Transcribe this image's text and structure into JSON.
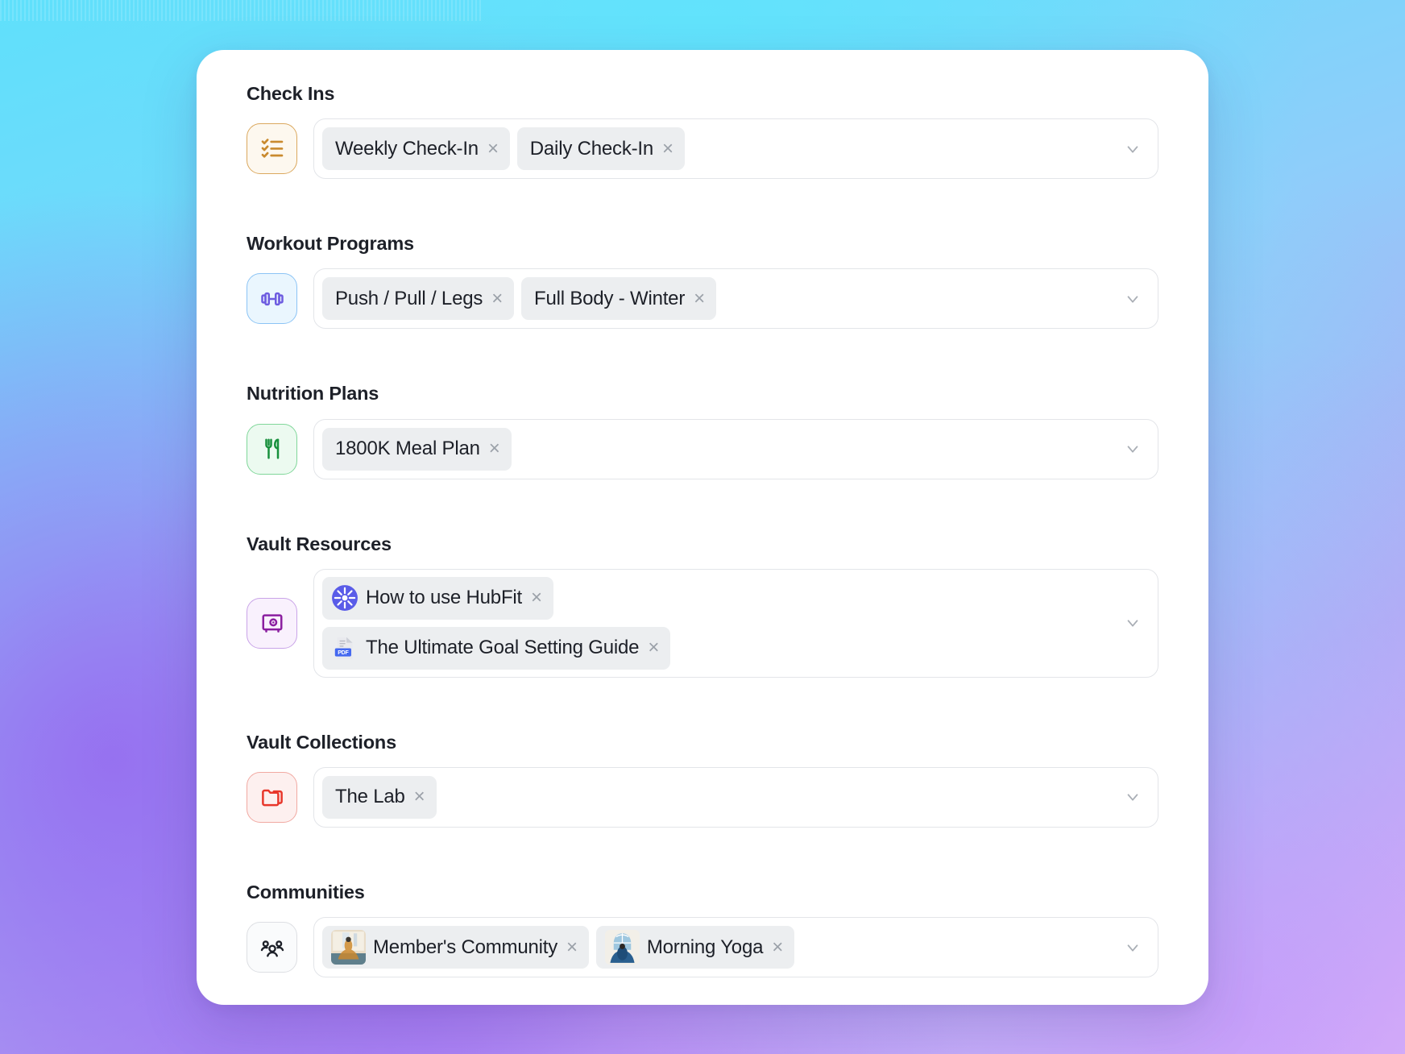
{
  "card": {
    "sections": [
      {
        "key": "check_ins",
        "label": "Check Ins",
        "icon_name": "checklist-icon",
        "icon_color": "#c98a2e",
        "badge_theme": "amber",
        "layout": "inline",
        "chips": [
          {
            "label": "Weekly Check-In",
            "close": "×",
            "icon": null
          },
          {
            "label": "Daily Check-In",
            "close": "×",
            "icon": null
          }
        ]
      },
      {
        "key": "workout_programs",
        "label": "Workout Programs",
        "icon_name": "dumbbell-icon",
        "icon_color": "#6d5ce0",
        "badge_theme": "blue",
        "layout": "inline",
        "chips": [
          {
            "label": "Push / Pull / Legs",
            "close": "×",
            "icon": null
          },
          {
            "label": "Full Body - Winter",
            "close": "×",
            "icon": null
          }
        ]
      },
      {
        "key": "nutrition_plans",
        "label": "Nutrition Plans",
        "icon_name": "fork-knife-icon",
        "icon_color": "#17903c",
        "badge_theme": "green",
        "layout": "inline",
        "chips": [
          {
            "label": "1800K Meal Plan",
            "close": "×",
            "icon": null
          }
        ]
      },
      {
        "key": "vault_resources",
        "label": "Vault Resources",
        "icon_name": "vault-safe-icon",
        "icon_color": "#8b1fa0",
        "badge_theme": "purple",
        "layout": "stacked",
        "chips": [
          {
            "label": "How to use HubFit",
            "close": "×",
            "icon": "hubfit-sunburst-icon"
          },
          {
            "label": "The Ultimate Goal Setting Guide",
            "close": "×",
            "icon": "pdf-file-icon"
          }
        ]
      },
      {
        "key": "vault_collections",
        "label": "Vault Collections",
        "icon_name": "folders-icon",
        "icon_color": "#e8372b",
        "badge_theme": "red",
        "layout": "inline",
        "chips": [
          {
            "label": "The Lab",
            "close": "×",
            "icon": null
          }
        ]
      },
      {
        "key": "communities",
        "label": "Communities",
        "icon_name": "people-group-icon",
        "icon_color": "#1d2028",
        "badge_theme": "gray",
        "layout": "inline",
        "chips": [
          {
            "label": "Member's Community",
            "close": "×",
            "icon": "avatar-yoga-beige"
          },
          {
            "label": "Morning Yoga",
            "close": "×",
            "icon": "avatar-yoga-blue"
          }
        ]
      }
    ],
    "dropdown_icon": "chevron-down-icon"
  }
}
